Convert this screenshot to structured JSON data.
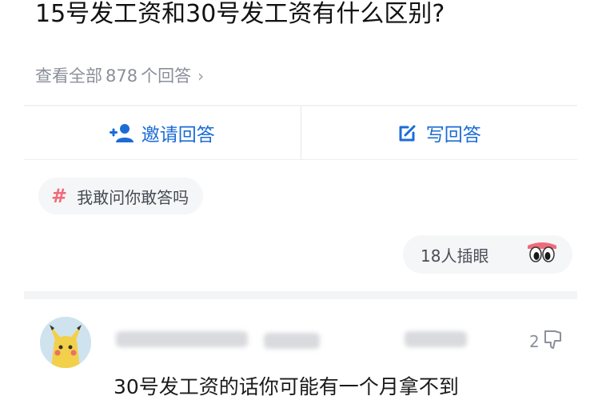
{
  "question": {
    "title": "15号发工资和30号发工资有什么区别?"
  },
  "answers_link": {
    "prefix": "查看全部",
    "count": "878",
    "suffix": "个回答",
    "chevron": "›"
  },
  "actions": [
    {
      "label": "邀请回答",
      "icon": "add-person-icon"
    },
    {
      "label": "写回答",
      "icon": "edit-icon"
    }
  ],
  "topic_tag": {
    "icon": "hash-icon",
    "label": "我敢问你敢答吗"
  },
  "reaction": {
    "label": "18人插眼",
    "icon": "eyes-emoji-icon"
  },
  "answer": {
    "likes": "2",
    "text": "30号发工资的话你可能有一个月拿不到"
  },
  "colors": {
    "accent": "#1c6cd8",
    "tag_hash": "#ef6b7a",
    "muted": "#8a8f99"
  }
}
